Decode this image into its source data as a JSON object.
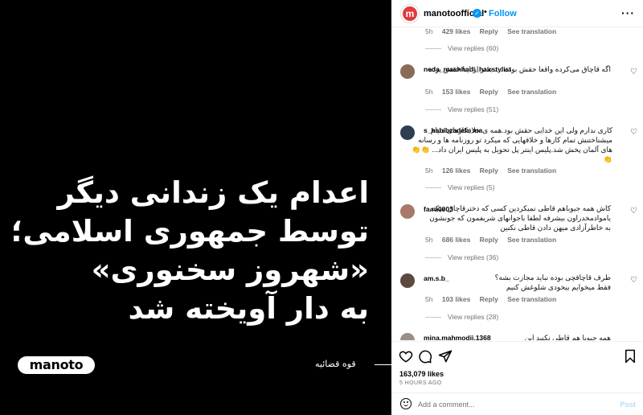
{
  "media": {
    "headline": [
      "اعدام یک زندانی دیگر",
      "توسط جمهوری اسلامی؛",
      "«شهروز سخنوری»",
      "به دار آویخته شد"
    ],
    "logo": "manoto",
    "caption": "قوه قضائیه"
  },
  "header": {
    "avatar_letter": "m",
    "username": "manotoofficial",
    "dot": "•",
    "follow_label": "Follow",
    "more": "···"
  },
  "top_meta": {
    "time": "5h",
    "likes": "429 likes",
    "reply": "Reply",
    "translation": "See translation"
  },
  "comments": [
    {
      "username": "neda_mashhadi_hairstylist",
      "text": "اگه قاچاق می‌کرده واقعا حقش بوده .... بدتر از اینا حقش بوده",
      "time": "5h",
      "likes": "153 likes",
      "reply": "Reply",
      "translation": "See translation",
      "view_replies": "View replies (51)"
    },
    {
      "username": "s_habibzadeh_ma",
      "text": "کاری ندارم ولی این خدایی حقش بود.همه ی خلافکارهای دنیام میشناختنش تمام کارها و خلافهایی که میکرد تو روزنامه ها و رسانه های آلمان پخش شد.پلیس اینتر پل تحویل به پلیس ایران داد... 👏👏👏",
      "time": "5h",
      "likes": "126 likes",
      "reply": "Reply",
      "translation": "See translation",
      "view_replies": "View replies (5)"
    },
    {
      "username": "fa.ra0003",
      "text": "کاش همه جیوباهم قاطی نمیکردین کسی که دخترقاچاق میکنه یاموادمخدراون بیشرفه لطفا باجوانهای شریفمون که جونشون به خاطرآزادی میهن دادن قاطی نکنین",
      "time": "5h",
      "likes": "686 likes",
      "reply": "Reply",
      "translation": "See translation",
      "view_replies": "View replies (36)"
    },
    {
      "username": "am.s.b_",
      "text": "طرف قاچاقچی بوده نباید مجازت بشه؟ فقط میخوایم بیخودی شلوغش کنیم",
      "time": "5h",
      "likes": "103 likes",
      "reply": "Reply",
      "translation": "See translation",
      "view_replies": "View replies (28)"
    },
    {
      "username": "mina.mahmodii.1368",
      "text": "همه جیوبا هم قاطی نکنید این حقش بوده"
    }
  ],
  "first_view_replies": "View replies (60)",
  "footer": {
    "likes": "163,079 likes",
    "time": "5 HOURS AGO",
    "placeholder": "Add a comment...",
    "post_label": "Post"
  }
}
